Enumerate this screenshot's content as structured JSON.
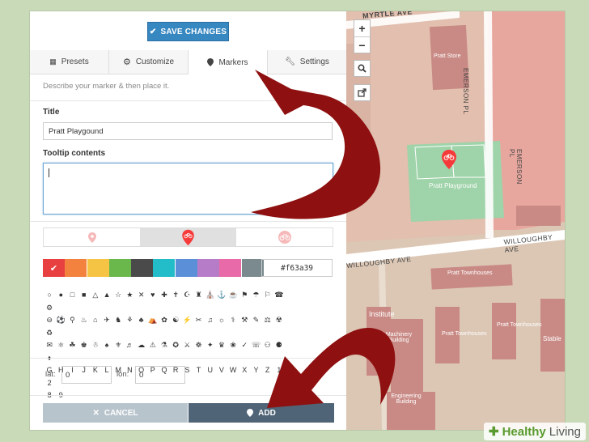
{
  "toolbar": {
    "save_label": "SAVE CHANGES"
  },
  "tabs": [
    {
      "label": "Presets",
      "icon": "grid-icon"
    },
    {
      "label": "Customize",
      "icon": "gear-icon"
    },
    {
      "label": "Markers",
      "icon": "map-pin-icon",
      "active": true
    },
    {
      "label": "Settings",
      "icon": "wrench-icon"
    }
  ],
  "hint": "Describe your marker & then place it.",
  "form": {
    "title_label": "Title",
    "title_value": "Pratt Playgound",
    "tooltip_label": "Tooltip contents",
    "tooltip_value": "",
    "color_hex": "#f63a39",
    "lat_label": "lat:",
    "lat_value": "0",
    "lon_label": "lon:",
    "lon_value": "0"
  },
  "colors": [
    "#e84040",
    "#f2823d",
    "#f6c445",
    "#6ab84c",
    "#4a4a4a",
    "#23bcc9",
    "#5b8fd8",
    "#b77cc8",
    "#e86aa8",
    "#7a8a8e"
  ],
  "icon_rows": [
    "○ ● □ ■ △ ▲ ☆ ★ ✕ ♥ ✚ ✝ ☪ ♜ ⛪ ⚓ ☕ ⚑ ☂ ⚐ ☎ ⚙",
    "⊖ ⚽ ⚲ ♨ ⌂ ✈ ♞ ⚘ ♣ ⛺ ✿ ☯ ⚡ ✂ ♫ ☼ ⚕ ⚒ ✎ ⚖ ☢ ♻",
    "✉ ⚛ ☘ ♚ ☃ ♠ ⚜ ♬ ☁ ⚠ ⚗ ✪ ⚔ ☸ ✦ ♛ ❀ ✓ ☏ ⚇ ⚈ ♦",
    "G H I J K L M N O P Q R S T U V W X Y Z 1 2",
    "8 9"
  ],
  "buttons": {
    "cancel": "CANCEL",
    "add": "ADD"
  },
  "map": {
    "streets": [
      "MYRTLE AVE",
      "EMERSON PL",
      "EMERSON PL",
      "WILLOUGHBY AVE",
      "WILLOUGHBY AVE"
    ],
    "places": [
      "Pratt Store",
      "Pratt Playground",
      "Pratt Townhouses",
      "Pratt Townhouses",
      "Pratt Townhouses",
      "Institute",
      "Machinery Building",
      "Engineering Building",
      "Stable"
    ],
    "zoom_in": "+",
    "zoom_out": "−"
  },
  "watermark": {
    "brand": "Healthy",
    "rest": "Living"
  }
}
